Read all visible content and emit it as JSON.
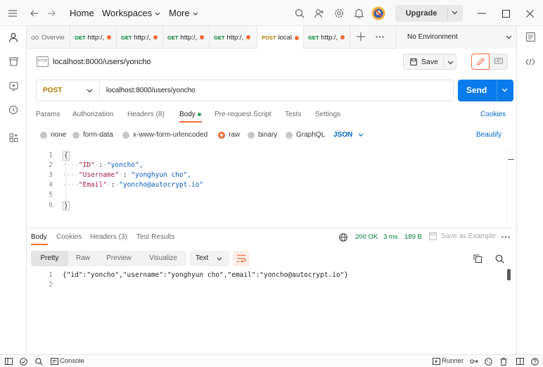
{
  "titlebar": {
    "home": "Home",
    "workspaces": "Workspaces",
    "more": "More",
    "upgrade": "Upgrade"
  },
  "tabs": [
    {
      "method": "",
      "title": "Overvie",
      "active": false
    },
    {
      "method": "GET",
      "title": "http:/,",
      "active": false
    },
    {
      "method": "GET",
      "title": "http:/,",
      "active": false
    },
    {
      "method": "GET",
      "title": "http:/,",
      "active": false
    },
    {
      "method": "GET",
      "title": "http:/,",
      "active": false
    },
    {
      "method": "POST",
      "title": "local",
      "active": true
    },
    {
      "method": "GET",
      "title": "http:/,",
      "active": false
    }
  ],
  "environment": "No Environment",
  "request": {
    "badge": "HTTP",
    "title": "localhost:8000/users/yoncho",
    "save": "Save",
    "method": "POST",
    "url": "localhost:8000/users/yoncho",
    "send": "Send"
  },
  "request_tabs": {
    "params": "Params",
    "authorization": "Authorization",
    "headers": "Headers (8)",
    "body": "Body",
    "prerequest": "Pre-request Script",
    "tests": "Tests",
    "settings": "Settings",
    "cookies": "Cookies"
  },
  "body_types": {
    "none": "none",
    "form_data": "form-data",
    "urlencoded": "x-www-form-urlencoded",
    "raw": "raw",
    "binary": "binary",
    "graphql": "GraphQL",
    "format": "JSON",
    "beautify": "Beautify"
  },
  "editor": {
    "line_numbers": [
      "1",
      "2",
      "3",
      "4",
      "5",
      "6"
    ],
    "open_brace": "{",
    "close_brace": "}",
    "lines": [
      {
        "key": "\"ID\"",
        "value": "\"yoncho\","
      },
      {
        "key": "\"Username\"",
        "value": "\"yonghyun cho\","
      },
      {
        "key": "\"Email\"",
        "value": "\"yoncho@autocrypt.io\""
      }
    ]
  },
  "response_tabs": {
    "body": "Body",
    "cookies": "Cookies",
    "headers": "Headers (3)",
    "test_results": "Test Results"
  },
  "response_status": {
    "status": "200 OK",
    "time": "3 ms",
    "size": "189 B",
    "save_example": "Save as Example"
  },
  "view_modes": {
    "pretty": "Pretty",
    "raw": "Raw",
    "preview": "Preview",
    "visualize": "Visualize",
    "text_format": "Text"
  },
  "response": {
    "line_numbers": [
      "1",
      "2"
    ],
    "body": "{\"id\":\"yoncho\",\"username\":\"yonghyun cho\",\"email\":\"yoncho@autocrypt.io\"}"
  },
  "statusbar": {
    "console": "Console",
    "runner": "Runner"
  },
  "colors": {
    "accent": "#f26b3a",
    "send": "#097bed",
    "link": "#0265d2",
    "status_ok": "#007f31",
    "post": "#ad7a03",
    "get": "#007f31"
  }
}
